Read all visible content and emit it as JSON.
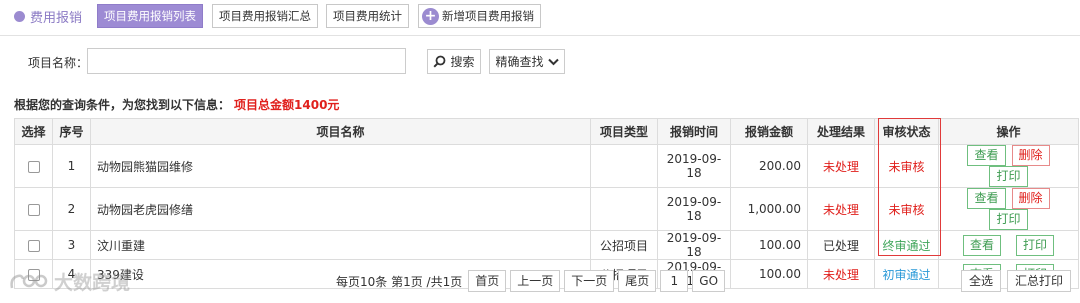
{
  "nav": {
    "brand": "费用报销",
    "tabs": [
      "项目费用报销列表",
      "项目费用报销汇总",
      "项目费用统计"
    ],
    "add_label": "新增项目费用报销",
    "colors": {
      "accent": "#9d8bd4"
    }
  },
  "search": {
    "label": "项目名称：",
    "value": "",
    "button": "搜索",
    "precise": "精确查找"
  },
  "result": {
    "info": "根据您的查询条件，为您找到以下信息：",
    "total": "项目总金额1400元"
  },
  "table": {
    "headers": [
      "选择",
      "序号",
      "项目名称",
      "项目类型",
      "报销时间",
      "报销金额",
      "处理结果",
      "审核状态",
      "操作"
    ],
    "rows": [
      {
        "no": "1",
        "name": "动物园熊猫园维修",
        "type": "",
        "date": "2019-09-18",
        "amount": "200.00",
        "result": "未处理",
        "status": "未审核"
      },
      {
        "no": "2",
        "name": "动物园老虎园修缮",
        "type": "",
        "date": "2019-09-18",
        "amount": "1,000.00",
        "result": "未处理",
        "status": "未审核"
      },
      {
        "no": "3",
        "name": "汶川重建",
        "type": "公招项目",
        "date": "2019-09-18",
        "amount": "100.00",
        "result": "已处理",
        "status": "终审通过"
      },
      {
        "no": "4",
        "name": "339建设",
        "type": "公招项目",
        "date": "2019-09-18",
        "amount": "100.00",
        "result": "未处理",
        "status": "初审通过"
      }
    ],
    "actions": {
      "view": "查看",
      "delete": "删除",
      "print": "打印"
    }
  },
  "pager": {
    "info": "每页10条 第1页 /共1页",
    "first": "首页",
    "prev": "上一页",
    "next": "下一页",
    "last": "尾页",
    "page_value": "1",
    "go": "GO"
  },
  "bottom": {
    "select_all": "全选",
    "summary_print": "汇总打印"
  },
  "watermark": "大数跨境"
}
